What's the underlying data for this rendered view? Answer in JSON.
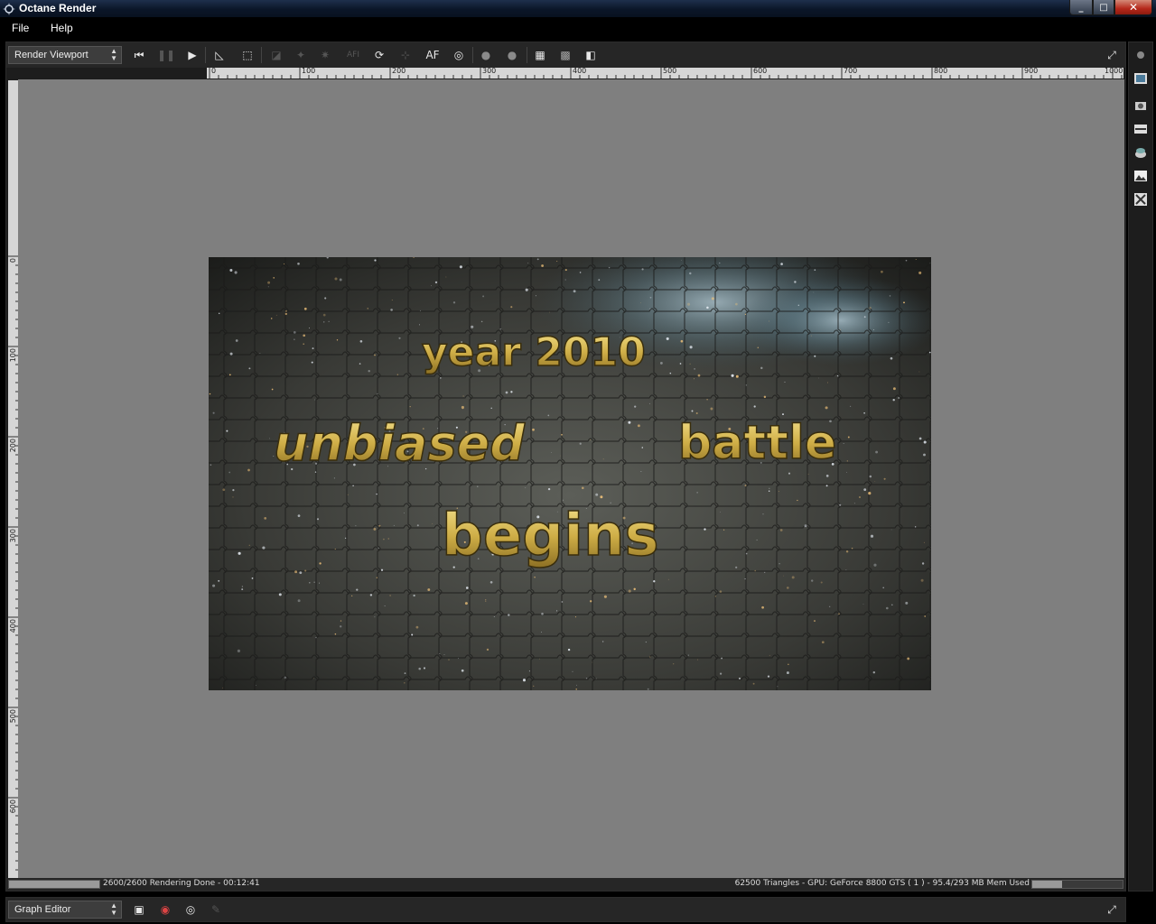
{
  "window": {
    "title": "Octane Render",
    "minimize": "_",
    "maximize": "□",
    "close": "✕"
  },
  "menu": {
    "file": "File",
    "help": "Help"
  },
  "viewport": {
    "selector": "Render Viewport",
    "af_label": "AF",
    "afi_label": "AFI",
    "hruler_labels": [
      "0",
      "100",
      "200",
      "300",
      "400",
      "500",
      "600",
      "700",
      "800",
      "900",
      "1000"
    ],
    "vruler_labels": [
      "0",
      "100",
      "200",
      "300",
      "400",
      "500",
      "600"
    ],
    "render_text": {
      "line1": "year 2010",
      "line2a": "unbiased",
      "line2b": "battle",
      "line3": "begins"
    },
    "status_left": "2600/2600 Rendering Done - 00:12:41",
    "status_right": "62500 Triangles - GPU: GeForce 8800 GTS ( 1 ) - 95.4/293 MB Mem Used",
    "render_progress": 1.0,
    "memory_usage": 0.33
  },
  "graph": {
    "selector": "Graph Editor"
  },
  "colors": {
    "canvas": "#7f7f7f",
    "panel": "#262626",
    "gold_text": "#d6b954"
  }
}
